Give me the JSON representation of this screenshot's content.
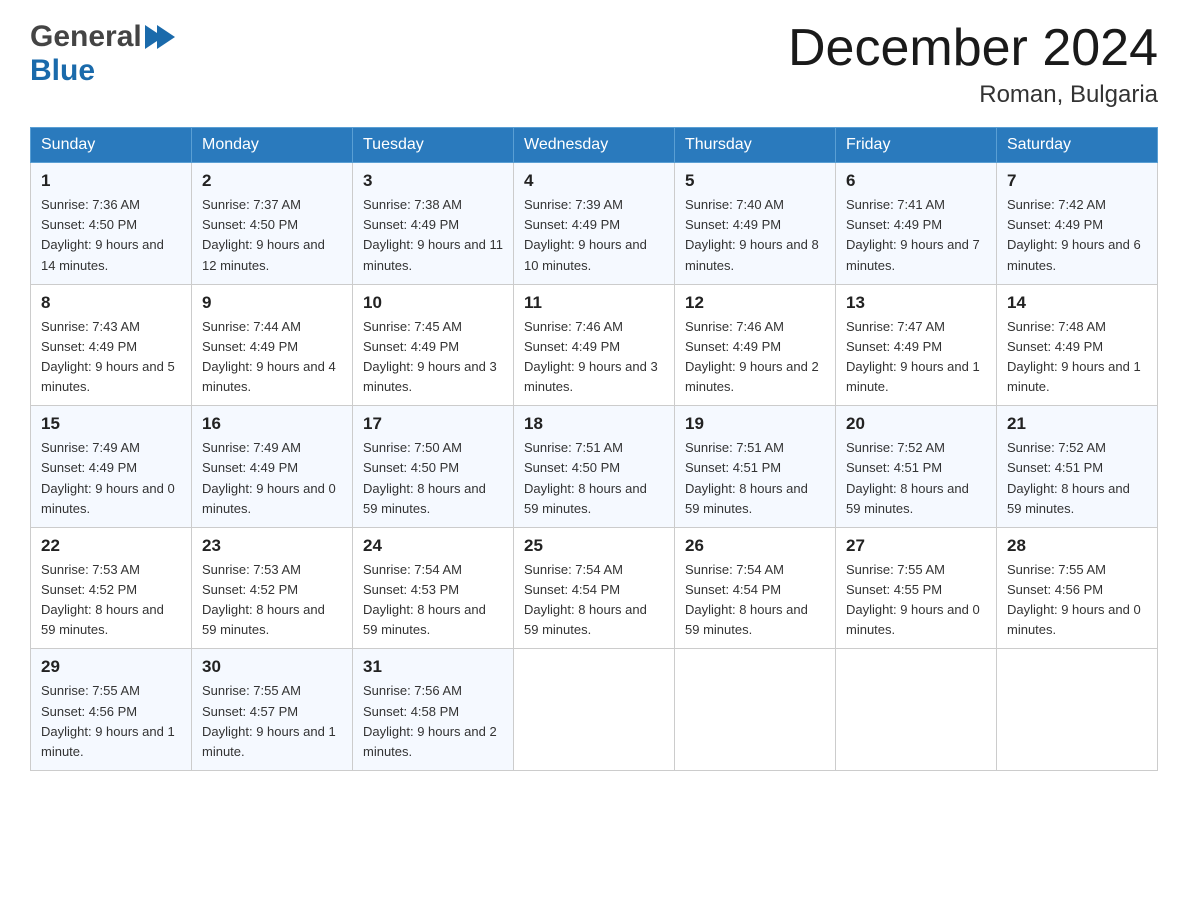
{
  "header": {
    "month_title": "December 2024",
    "location": "Roman, Bulgaria",
    "logo_general": "General",
    "logo_blue": "Blue"
  },
  "days_of_week": [
    "Sunday",
    "Monday",
    "Tuesday",
    "Wednesday",
    "Thursday",
    "Friday",
    "Saturday"
  ],
  "weeks": [
    [
      {
        "day": "1",
        "sunrise": "7:36 AM",
        "sunset": "4:50 PM",
        "daylight": "9 hours and 14 minutes."
      },
      {
        "day": "2",
        "sunrise": "7:37 AM",
        "sunset": "4:50 PM",
        "daylight": "9 hours and 12 minutes."
      },
      {
        "day": "3",
        "sunrise": "7:38 AM",
        "sunset": "4:49 PM",
        "daylight": "9 hours and 11 minutes."
      },
      {
        "day": "4",
        "sunrise": "7:39 AM",
        "sunset": "4:49 PM",
        "daylight": "9 hours and 10 minutes."
      },
      {
        "day": "5",
        "sunrise": "7:40 AM",
        "sunset": "4:49 PM",
        "daylight": "9 hours and 8 minutes."
      },
      {
        "day": "6",
        "sunrise": "7:41 AM",
        "sunset": "4:49 PM",
        "daylight": "9 hours and 7 minutes."
      },
      {
        "day": "7",
        "sunrise": "7:42 AM",
        "sunset": "4:49 PM",
        "daylight": "9 hours and 6 minutes."
      }
    ],
    [
      {
        "day": "8",
        "sunrise": "7:43 AM",
        "sunset": "4:49 PM",
        "daylight": "9 hours and 5 minutes."
      },
      {
        "day": "9",
        "sunrise": "7:44 AM",
        "sunset": "4:49 PM",
        "daylight": "9 hours and 4 minutes."
      },
      {
        "day": "10",
        "sunrise": "7:45 AM",
        "sunset": "4:49 PM",
        "daylight": "9 hours and 3 minutes."
      },
      {
        "day": "11",
        "sunrise": "7:46 AM",
        "sunset": "4:49 PM",
        "daylight": "9 hours and 3 minutes."
      },
      {
        "day": "12",
        "sunrise": "7:46 AM",
        "sunset": "4:49 PM",
        "daylight": "9 hours and 2 minutes."
      },
      {
        "day": "13",
        "sunrise": "7:47 AM",
        "sunset": "4:49 PM",
        "daylight": "9 hours and 1 minute."
      },
      {
        "day": "14",
        "sunrise": "7:48 AM",
        "sunset": "4:49 PM",
        "daylight": "9 hours and 1 minute."
      }
    ],
    [
      {
        "day": "15",
        "sunrise": "7:49 AM",
        "sunset": "4:49 PM",
        "daylight": "9 hours and 0 minutes."
      },
      {
        "day": "16",
        "sunrise": "7:49 AM",
        "sunset": "4:49 PM",
        "daylight": "9 hours and 0 minutes."
      },
      {
        "day": "17",
        "sunrise": "7:50 AM",
        "sunset": "4:50 PM",
        "daylight": "8 hours and 59 minutes."
      },
      {
        "day": "18",
        "sunrise": "7:51 AM",
        "sunset": "4:50 PM",
        "daylight": "8 hours and 59 minutes."
      },
      {
        "day": "19",
        "sunrise": "7:51 AM",
        "sunset": "4:51 PM",
        "daylight": "8 hours and 59 minutes."
      },
      {
        "day": "20",
        "sunrise": "7:52 AM",
        "sunset": "4:51 PM",
        "daylight": "8 hours and 59 minutes."
      },
      {
        "day": "21",
        "sunrise": "7:52 AM",
        "sunset": "4:51 PM",
        "daylight": "8 hours and 59 minutes."
      }
    ],
    [
      {
        "day": "22",
        "sunrise": "7:53 AM",
        "sunset": "4:52 PM",
        "daylight": "8 hours and 59 minutes."
      },
      {
        "day": "23",
        "sunrise": "7:53 AM",
        "sunset": "4:52 PM",
        "daylight": "8 hours and 59 minutes."
      },
      {
        "day": "24",
        "sunrise": "7:54 AM",
        "sunset": "4:53 PM",
        "daylight": "8 hours and 59 minutes."
      },
      {
        "day": "25",
        "sunrise": "7:54 AM",
        "sunset": "4:54 PM",
        "daylight": "8 hours and 59 minutes."
      },
      {
        "day": "26",
        "sunrise": "7:54 AM",
        "sunset": "4:54 PM",
        "daylight": "8 hours and 59 minutes."
      },
      {
        "day": "27",
        "sunrise": "7:55 AM",
        "sunset": "4:55 PM",
        "daylight": "9 hours and 0 minutes."
      },
      {
        "day": "28",
        "sunrise": "7:55 AM",
        "sunset": "4:56 PM",
        "daylight": "9 hours and 0 minutes."
      }
    ],
    [
      {
        "day": "29",
        "sunrise": "7:55 AM",
        "sunset": "4:56 PM",
        "daylight": "9 hours and 1 minute."
      },
      {
        "day": "30",
        "sunrise": "7:55 AM",
        "sunset": "4:57 PM",
        "daylight": "9 hours and 1 minute."
      },
      {
        "day": "31",
        "sunrise": "7:56 AM",
        "sunset": "4:58 PM",
        "daylight": "9 hours and 2 minutes."
      },
      null,
      null,
      null,
      null
    ]
  ],
  "labels": {
    "sunrise": "Sunrise:",
    "sunset": "Sunset:",
    "daylight": "Daylight:"
  }
}
